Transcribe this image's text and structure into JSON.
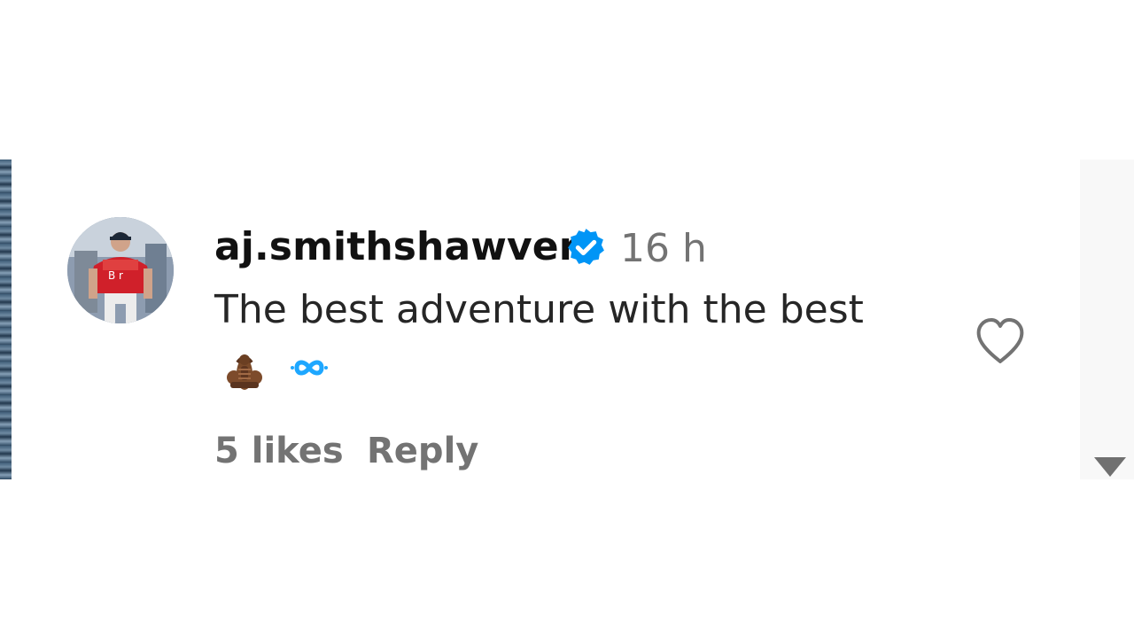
{
  "comment": {
    "username": "aj.smithshawver",
    "timestamp": "16 h",
    "text": "The best adventure with the best",
    "emojis": [
      "scorpio-emoji-icon",
      "infinity-emoji-icon"
    ],
    "likes_label": "5 likes",
    "reply_label": "Reply",
    "is_verified": true
  },
  "icons": {
    "verified": "verified-badge-icon",
    "like": "heart-outline-icon",
    "scroll_down": "scroll-down-arrow-icon",
    "avatar": "avatar"
  },
  "colors": {
    "primary_text": "#262626",
    "username_text": "#111111",
    "secondary_text": "#737373",
    "verified_blue": "#0095f6"
  }
}
